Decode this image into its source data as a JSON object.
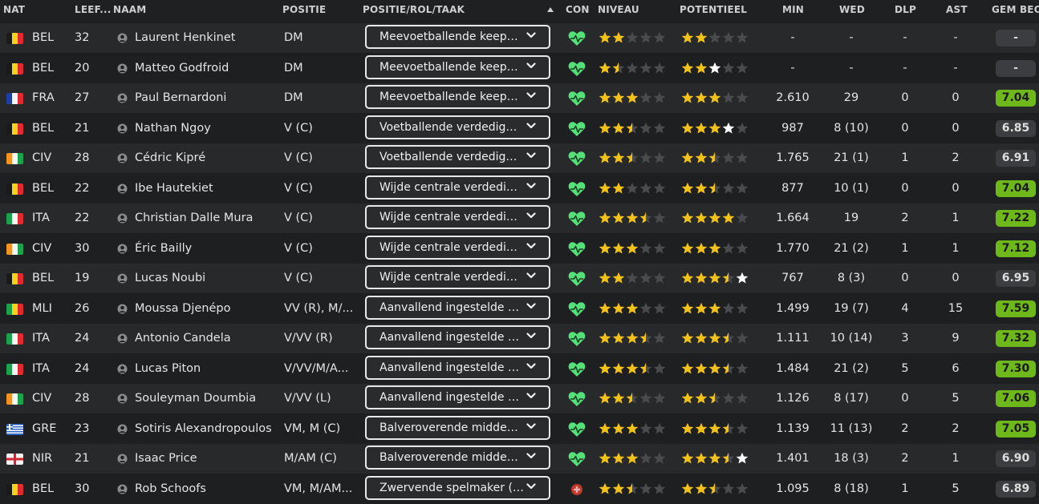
{
  "header": {
    "nat": "NAT",
    "age": "LEEF...",
    "name": "NAAM",
    "position": "POSITIE",
    "role": "POSITIE/ROL/TAAK",
    "con": "CON",
    "niveau": "NIVEAU",
    "potentieel": "POTENTIEEL",
    "min": "MIN",
    "wed": "WED",
    "dlp": "DLP",
    "ast": "AST",
    "gem": "GEM BEO"
  },
  "colors": {
    "star": "#f2c21b",
    "star_white": "#ffffff",
    "star_empty": "#4a4b4e",
    "heart": "#55e07a",
    "injury": "#c0392b",
    "rating_green": "#6fb81c"
  },
  "icons": {
    "sort": "sort-up-icon",
    "person": "person-icon",
    "chevron": "chevron-down-icon",
    "heart": "heart-icon",
    "injury": "injury-icon"
  },
  "players": [
    {
      "flag": "BEL",
      "nat": "BEL",
      "age": "32",
      "name": "Laurent Henkinet",
      "position": "DM",
      "role": "Meevoetballende keeper (Verdedigen)",
      "con": "heart",
      "niveau": {
        "full": 2,
        "half": 0,
        "white": 0
      },
      "potentieel": {
        "full": 2,
        "half": 0,
        "white": 0
      },
      "min": "-",
      "wed": "-",
      "dlp": "-",
      "ast": "-",
      "rating": "-",
      "rating_style": "dark"
    },
    {
      "flag": "BEL",
      "nat": "BEL",
      "age": "20",
      "name": "Matteo Godfroid",
      "position": "DM",
      "role": "Meevoetballende keeper (Verdedigen)",
      "con": "heart",
      "niveau": {
        "full": 1,
        "half": 1,
        "white": 0
      },
      "potentieel": {
        "full": 2,
        "half": 0,
        "white": 1
      },
      "min": "-",
      "wed": "-",
      "dlp": "-",
      "ast": "-",
      "rating": "-",
      "rating_style": "dark"
    },
    {
      "flag": "FRA",
      "nat": "FRA",
      "age": "27",
      "name": "Paul Bernardoni",
      "position": "DM",
      "role": "Meevoetballende keeper (Verdedigen)",
      "con": "heart",
      "niveau": {
        "full": 3,
        "half": 0,
        "white": 0
      },
      "potentieel": {
        "full": 3,
        "half": 0,
        "white": 0
      },
      "min": "2.610",
      "wed": "29",
      "dlp": "0",
      "ast": "0",
      "rating": "7.04",
      "rating_style": "green"
    },
    {
      "flag": "BEL",
      "nat": "BEL",
      "age": "21",
      "name": "Nathan Ngoy",
      "position": "V (C)",
      "role": "Voetballende verdediger (Verdedigen)",
      "con": "heart",
      "niveau": {
        "full": 2,
        "half": 1,
        "white": 0
      },
      "potentieel": {
        "full": 3,
        "half": 0,
        "white": 1
      },
      "min": "987",
      "wed": "8 (10)",
      "dlp": "0",
      "ast": "0",
      "rating": "6.85",
      "rating_style": "dark"
    },
    {
      "flag": "CIV",
      "nat": "CIV",
      "age": "28",
      "name": "Cédric Kipré",
      "position": "V (C)",
      "role": "Voetballende verdediger (Verdedigen)",
      "con": "heart",
      "niveau": {
        "full": 2,
        "half": 1,
        "white": 0
      },
      "potentieel": {
        "full": 2,
        "half": 1,
        "white": 0
      },
      "min": "1.765",
      "wed": "21 (1)",
      "dlp": "1",
      "ast": "2",
      "rating": "6.91",
      "rating_style": "dark"
    },
    {
      "flag": "BEL",
      "nat": "BEL",
      "age": "22",
      "name": "Ibe Hautekiet",
      "position": "V (C)",
      "role": "Wijde centrale verdediger (Verdedigen)",
      "con": "heart",
      "niveau": {
        "full": 2,
        "half": 0,
        "white": 0
      },
      "potentieel": {
        "full": 2,
        "half": 1,
        "white": 0
      },
      "min": "877",
      "wed": "10 (1)",
      "dlp": "0",
      "ast": "0",
      "rating": "7.04",
      "rating_style": "green"
    },
    {
      "flag": "ITA",
      "nat": "ITA",
      "age": "22",
      "name": "Christian Dalle Mura",
      "position": "V (C)",
      "role": "Wijde centrale verdediger (Verdedigen)",
      "con": "heart",
      "niveau": {
        "full": 3,
        "half": 1,
        "white": 0
      },
      "potentieel": {
        "full": 4,
        "half": 0,
        "white": 0
      },
      "min": "1.664",
      "wed": "19",
      "dlp": "2",
      "ast": "1",
      "rating": "7.22",
      "rating_style": "green"
    },
    {
      "flag": "CIV",
      "nat": "CIV",
      "age": "30",
      "name": "Éric Bailly",
      "position": "V (C)",
      "role": "Wijde centrale verdediger (Verdedigen)",
      "con": "heart",
      "niveau": {
        "full": 3,
        "half": 0,
        "white": 0
      },
      "potentieel": {
        "full": 3,
        "half": 0,
        "white": 0
      },
      "min": "1.770",
      "wed": "21 (2)",
      "dlp": "1",
      "ast": "1",
      "rating": "7.12",
      "rating_style": "green"
    },
    {
      "flag": "BEL",
      "nat": "BEL",
      "age": "19",
      "name": "Lucas Noubi",
      "position": "V (C)",
      "role": "Wijde centrale verdediger (Verdedigen)",
      "con": "heart",
      "niveau": {
        "full": 2,
        "half": 0,
        "white": 0
      },
      "potentieel": {
        "full": 3,
        "half": 1,
        "white": 1
      },
      "min": "767",
      "wed": "8 (3)",
      "dlp": "0",
      "ast": "0",
      "rating": "6.95",
      "rating_style": "dark"
    },
    {
      "flag": "MLI",
      "nat": "MLI",
      "age": "26",
      "name": "Moussa Djenépo",
      "position": "VV (R), M/...",
      "role": "Aanvallend ingestelde vleugelverdediger",
      "con": "heart",
      "niveau": {
        "full": 3,
        "half": 0,
        "white": 0
      },
      "potentieel": {
        "full": 3,
        "half": 0,
        "white": 0
      },
      "min": "1.499",
      "wed": "19 (7)",
      "dlp": "4",
      "ast": "15",
      "rating": "7.59",
      "rating_style": "green"
    },
    {
      "flag": "ITA",
      "nat": "ITA",
      "age": "24",
      "name": "Antonio Candela",
      "position": "V/VV (R)",
      "role": "Aanvallend ingestelde vleugelverdediger",
      "con": "heart",
      "niveau": {
        "full": 3,
        "half": 1,
        "white": 0
      },
      "potentieel": {
        "full": 3,
        "half": 1,
        "white": 0
      },
      "min": "1.111",
      "wed": "10 (14)",
      "dlp": "3",
      "ast": "9",
      "rating": "7.32",
      "rating_style": "green"
    },
    {
      "flag": "ITA",
      "nat": "ITA",
      "age": "24",
      "name": "Lucas Piton",
      "position": "V/VV/M/A...",
      "role": "Aanvallend ingestelde vleugelverdediger",
      "con": "heart",
      "niveau": {
        "full": 3,
        "half": 1,
        "white": 0
      },
      "potentieel": {
        "full": 3,
        "half": 1,
        "white": 0
      },
      "min": "1.484",
      "wed": "21 (2)",
      "dlp": "5",
      "ast": "6",
      "rating": "7.30",
      "rating_style": "green"
    },
    {
      "flag": "CIV",
      "nat": "CIV",
      "age": "28",
      "name": "Souleyman Doumbia",
      "position": "V/VV (L)",
      "role": "Aanvallend ingestelde vleugelverdediger",
      "con": "heart",
      "niveau": {
        "full": 2,
        "half": 1,
        "white": 0
      },
      "potentieel": {
        "full": 2,
        "half": 1,
        "white": 0
      },
      "min": "1.126",
      "wed": "8 (17)",
      "dlp": "0",
      "ast": "5",
      "rating": "7.06",
      "rating_style": "green"
    },
    {
      "flag": "GRE",
      "nat": "GRE",
      "age": "23",
      "name": "Sotiris Alexandropoulos",
      "position": "VM, M (C)",
      "role": "Balveroverende middenvelder (Verdedigen)",
      "con": "heart",
      "niveau": {
        "full": 3,
        "half": 0,
        "white": 0
      },
      "potentieel": {
        "full": 3,
        "half": 1,
        "white": 0
      },
      "min": "1.139",
      "wed": "11 (13)",
      "dlp": "2",
      "ast": "2",
      "rating": "7.05",
      "rating_style": "green"
    },
    {
      "flag": "NIR",
      "nat": "NIR",
      "age": "21",
      "name": "Isaac Price",
      "position": "M/AM (C)",
      "role": "Balveroverende middenvelder (Verdedigen)",
      "con": "heart",
      "niveau": {
        "full": 3,
        "half": 0,
        "white": 0
      },
      "potentieel": {
        "full": 3,
        "half": 1,
        "white": 1
      },
      "min": "1.401",
      "wed": "18 (3)",
      "dlp": "2",
      "ast": "1",
      "rating": "6.90",
      "rating_style": "dark"
    },
    {
      "flag": "BEL",
      "nat": "BEL",
      "age": "30",
      "name": "Rob Schoofs",
      "position": "VM, M/AM...",
      "role": "Zwervende spelmaker (Ondersteunen)",
      "con": "injury",
      "niveau": {
        "full": 2,
        "half": 1,
        "white": 0
      },
      "potentieel": {
        "full": 2,
        "half": 1,
        "white": 0
      },
      "min": "1.095",
      "wed": "8 (18)",
      "dlp": "1",
      "ast": "5",
      "rating": "6.89",
      "rating_style": "dark"
    }
  ]
}
